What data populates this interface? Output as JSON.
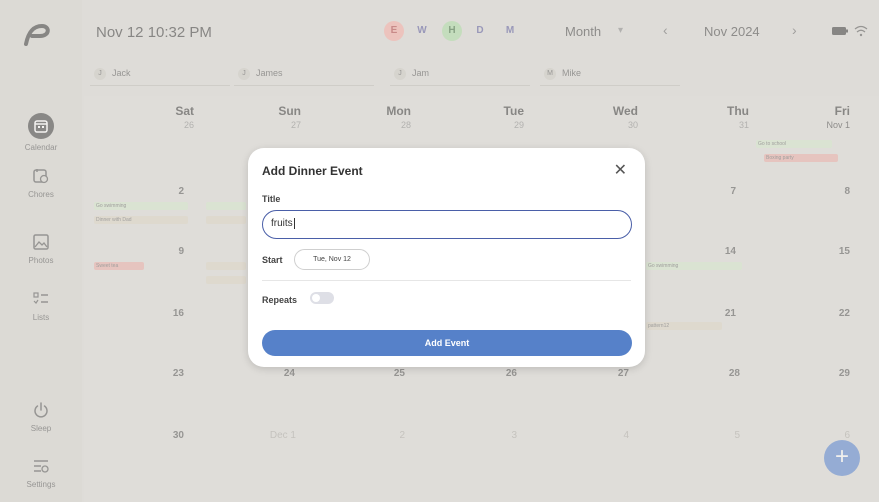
{
  "app": {
    "datetime": "Nov 12 10:32 PM",
    "view_buttons": [
      "E",
      "W",
      "H",
      "D",
      "M"
    ],
    "view_select": "Month",
    "month_label": "Nov 2024"
  },
  "sidebar": {
    "items": [
      {
        "label": "Calendar",
        "icon": "calendar-icon"
      },
      {
        "label": "Chores",
        "icon": "chores-icon"
      },
      {
        "label": "Photos",
        "icon": "photos-icon"
      },
      {
        "label": "Lists",
        "icon": "lists-icon"
      },
      {
        "label": "Sleep",
        "icon": "power-icon"
      },
      {
        "label": "Settings",
        "icon": "settings-icon"
      }
    ]
  },
  "people": [
    {
      "initial": "J",
      "name": "Jack"
    },
    {
      "initial": "J",
      "name": "James"
    },
    {
      "initial": "J",
      "name": "Jam"
    },
    {
      "initial": "M",
      "name": "Mike"
    }
  ],
  "calendar": {
    "days": [
      {
        "name": "Sat",
        "date": "26"
      },
      {
        "name": "Sun",
        "date": "27"
      },
      {
        "name": "Mon",
        "date": "28"
      },
      {
        "name": "Tue",
        "date": "29"
      },
      {
        "name": "Wed",
        "date": "30"
      },
      {
        "name": "Thu",
        "date": "31"
      },
      {
        "name": "Fri",
        "date": "Nov 1"
      }
    ],
    "week_numbers": [
      [
        "2",
        "",
        "",
        "",
        "",
        "7",
        "8"
      ],
      [
        "9",
        "",
        "",
        "",
        "",
        "14",
        "15"
      ],
      [
        "16",
        "",
        "",
        "",
        "",
        "21",
        "22"
      ],
      [
        "23",
        "24",
        "25",
        "26",
        "27",
        "28",
        "29"
      ],
      [
        "30",
        "Dec 1",
        "2",
        "3",
        "4",
        "5",
        "6"
      ]
    ],
    "events": {
      "go_swimming": "Go swimming",
      "dinner_with_dad": "Dinner with Dad",
      "go_to_school": "Go to school",
      "boxing_party": "Boxing party",
      "sweet_tea": "Sweet tea",
      "pattern": "pattern12"
    }
  },
  "modal": {
    "title": "Add  Dinner Event",
    "title_label": "Title",
    "title_value": "fruits",
    "start_label": "Start",
    "start_value": "Tue, Nov 12",
    "repeats_label": "Repeats",
    "repeats_on": false,
    "submit_label": "Add Event"
  },
  "colors": {
    "accent": "#5681c9",
    "fab": "#3b6fc9",
    "view_e": "#f0a8a0",
    "view_h": "#a8d8a0"
  }
}
